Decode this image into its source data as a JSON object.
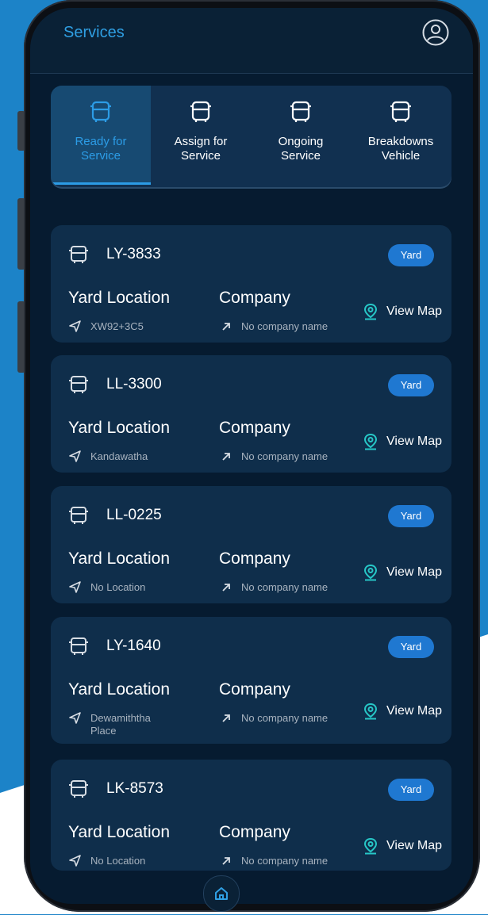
{
  "app": {
    "title": "Services"
  },
  "icons": {
    "profile": "user-circle-icon",
    "bus": "bus-icon",
    "location": "navigation-arrow-icon",
    "company": "arrow-up-right-icon",
    "map": "map-pin-icon",
    "home": "home-icon"
  },
  "colors": {
    "accent": "#2c9ce6",
    "badge": "#1f78d1",
    "screen_bg": "#061b30",
    "card_bg": "#0f2e4b"
  },
  "tabs": [
    {
      "line1": "Ready for",
      "line2": "Service",
      "active": true
    },
    {
      "line1": "Assign for",
      "line2": "Service",
      "active": false
    },
    {
      "line1": "Ongoing",
      "line2": "Service",
      "active": false
    },
    {
      "line1": "Breakdowns",
      "line2": "Vehicle",
      "active": false
    }
  ],
  "cards": [
    {
      "plate": "LY-3833",
      "badge": "Yard",
      "loc_title": "Yard Location",
      "loc_line1": "XW92+3C5",
      "loc_line2": "",
      "company_title": "Company",
      "company_value": "No company name",
      "action": "View Map"
    },
    {
      "plate": "LL-3300",
      "badge": "Yard",
      "loc_title": "Yard Location",
      "loc_line1": "Kandawatha",
      "loc_line2": "",
      "company_title": "Company",
      "company_value": "No company name",
      "action": "View Map"
    },
    {
      "plate": "LL-0225",
      "badge": "Yard",
      "loc_title": "Yard Location",
      "loc_line1": "No Location",
      "loc_line2": "",
      "company_title": "Company",
      "company_value": "No company name",
      "action": "View Map"
    },
    {
      "plate": "LY-1640",
      "badge": "Yard",
      "loc_title": "Yard Location",
      "loc_line1": "Dewamiththa",
      "loc_line2": "Place",
      "company_title": "Company",
      "company_value": "No company name",
      "action": "View Map"
    },
    {
      "plate": "LK-8573",
      "badge": "Yard",
      "loc_title": "Yard Location",
      "loc_line1": "No Location",
      "loc_line2": "",
      "company_title": "Company",
      "company_value": "No company name",
      "action": "View Map"
    }
  ]
}
